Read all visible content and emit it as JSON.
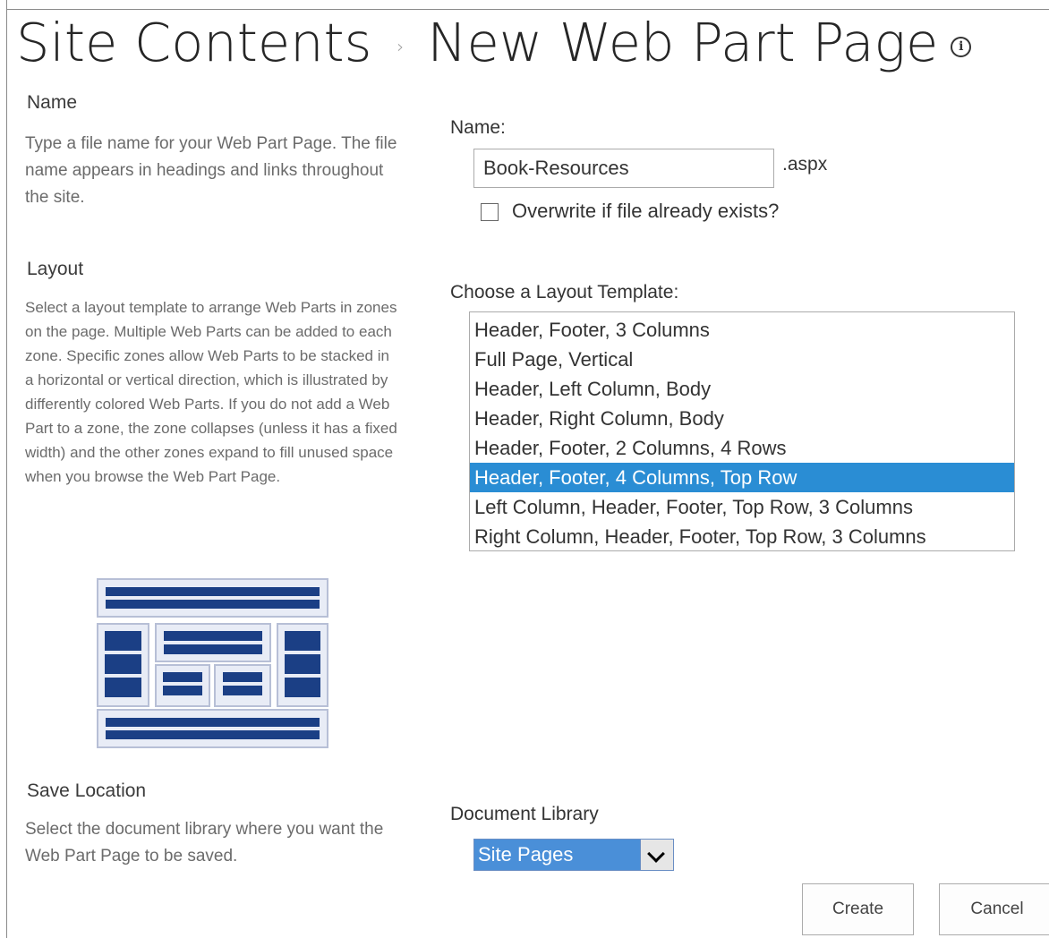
{
  "header": {
    "breadcrumb_root": "Site Contents",
    "breadcrumb_separator": "›",
    "page_title": "New Web Part Page",
    "info_icon": "info-icon"
  },
  "name_section": {
    "heading": "Name",
    "description": "Type a file name for your Web Part Page. The file name appears in headings and links throughout the site.",
    "field_label": "Name:",
    "file_name_value": "Book-Resources",
    "extension": ".aspx",
    "overwrite_label": "Overwrite if file already exists?",
    "overwrite_checked": false
  },
  "layout_section": {
    "heading": "Layout",
    "description": "Select a layout template to arrange Web Parts in zones on the page. Multiple Web Parts can be added to each zone. Specific zones allow Web Parts to be stacked in a horizontal or vertical direction, which is illustrated by differently colored Web Parts. If you do not add a Web Part to a zone, the zone collapses (unless it has a fixed width) and the other zones expand to fill unused space when you browse the Web Part Page.",
    "field_label": "Choose a Layout Template:",
    "options": [
      "Header, Footer, 3 Columns",
      "Full Page, Vertical",
      "Header, Left Column, Body",
      "Header, Right Column, Body",
      "Header, Footer, 2 Columns, 4 Rows",
      "Header, Footer, 4 Columns, Top Row",
      "Left Column, Header, Footer, Top Row, 3 Columns",
      "Right Column, Header, Footer, Top Row, 3 Columns"
    ],
    "selected_index": 5
  },
  "save_section": {
    "heading": "Save Location",
    "description": "Select the document library where you want the Web Part Page to be saved.",
    "field_label": "Document Library",
    "library_value": "Site Pages"
  },
  "actions": {
    "create_label": "Create",
    "cancel_label": "Cancel"
  },
  "colors": {
    "selection": "#2a8dd4",
    "preview_zone": "#1b3f85",
    "preview_frame": "#e8ecf6"
  }
}
